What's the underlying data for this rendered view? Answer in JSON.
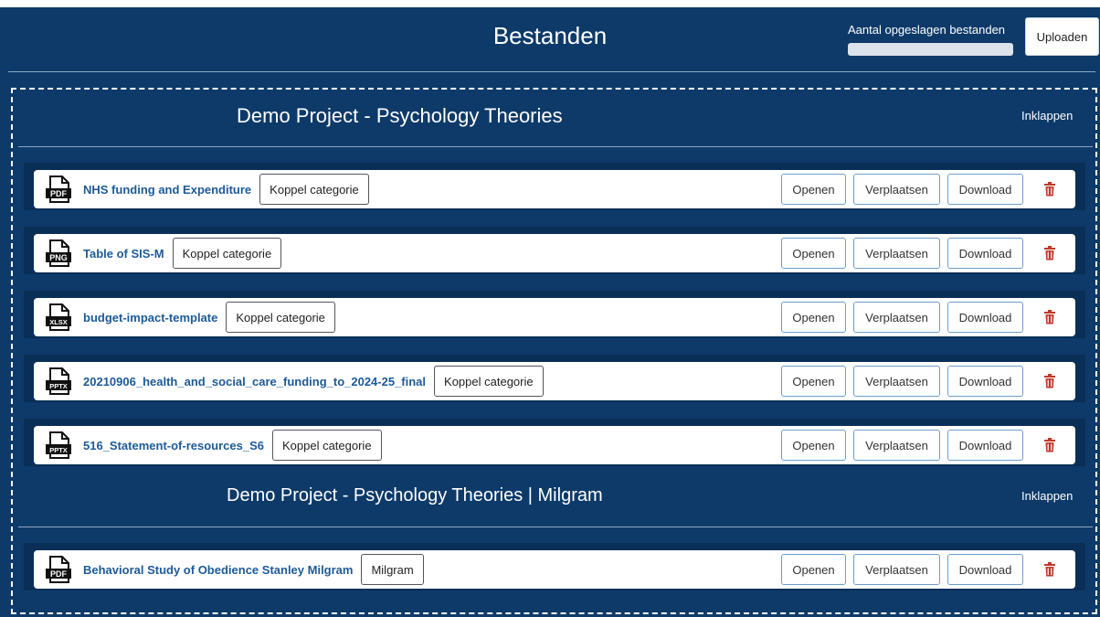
{
  "header": {
    "title": "Bestanden",
    "storage_label": "Aantal opgeslagen bestanden",
    "storage_fraction": 0.0,
    "upload_label": "Uploaden"
  },
  "projects": [
    {
      "title": "Demo Project - Psychology Theories",
      "collapse_label": "Inklappen",
      "files": [
        {
          "type": "PDF",
          "name": "NHS funding and Expenditure",
          "category": "Koppel categorie",
          "open": "Openen",
          "move": "Verplaatsen",
          "download": "Download"
        },
        {
          "type": "PNG",
          "name": "Table of SIS-M",
          "category": "Koppel categorie",
          "open": "Openen",
          "move": "Verplaatsen",
          "download": "Download"
        },
        {
          "type": "XLSX",
          "name": "budget-impact-template",
          "category": "Koppel categorie",
          "open": "Openen",
          "move": "Verplaatsen",
          "download": "Download"
        },
        {
          "type": "PPTX",
          "name": "20210906_health_and_social_care_funding_to_2024-25_final",
          "category": "Koppel categorie",
          "open": "Openen",
          "move": "Verplaatsen",
          "download": "Download"
        },
        {
          "type": "PPTX",
          "name": "516_Statement-of-resources_S6",
          "category": "Koppel categorie",
          "open": "Openen",
          "move": "Verplaatsen",
          "download": "Download"
        }
      ]
    },
    {
      "title": "Demo Project - Psychology Theories | Milgram",
      "collapse_label": "Inklappen",
      "files": [
        {
          "type": "PDF",
          "name": "Behavioral Study of Obedience Stanley Milgram",
          "category": "Milgram",
          "open": "Openen",
          "move": "Verplaatsen",
          "download": "Download"
        }
      ]
    }
  ],
  "icons": {
    "file": "file-type-icon",
    "delete": "trash-icon"
  },
  "colors": {
    "background": "#0d3a69",
    "band": "#0a2f57",
    "link": "#1d5a97",
    "delete": "#c0392b",
    "action_border": "#6e9fc9"
  }
}
